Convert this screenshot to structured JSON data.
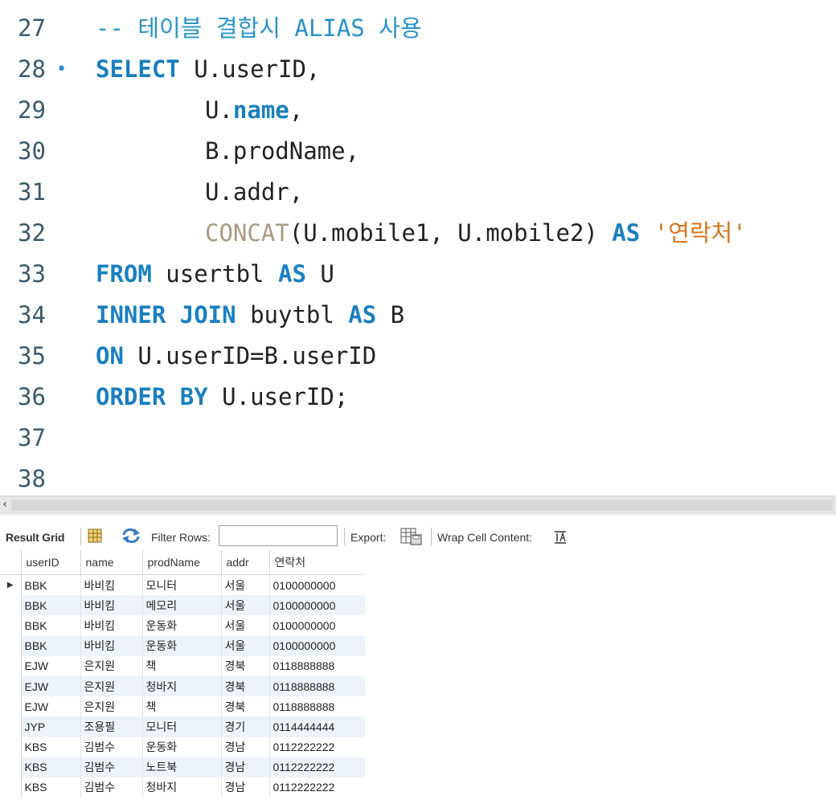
{
  "editor": {
    "lines": [
      {
        "num": "27",
        "comment": "-- 테이블 결합시 ALIAS 사용"
      },
      {
        "num": "28",
        "marker": "•",
        "kw1": "SELECT",
        "rest": " U.userID,"
      },
      {
        "num": "29",
        "pre": "U.",
        "kw1": "name",
        "rest": ","
      },
      {
        "num": "30",
        "text": "B.prodName,"
      },
      {
        "num": "31",
        "text": "U.addr,"
      },
      {
        "num": "32",
        "fn": "CONCAT",
        "mid": "(U.mobile1, U.mobile2) ",
        "kw1": "AS",
        "str": "'연락처'"
      },
      {
        "num": "33",
        "kw1": "FROM",
        "mid": " usertbl ",
        "kw2": "AS",
        "rest": " U"
      },
      {
        "num": "34",
        "kw1": "INNER JOIN",
        "mid": " buytbl ",
        "kw2": "AS",
        "rest": " B"
      },
      {
        "num": "35",
        "kw1": "ON",
        "rest": " U.userID=B.userID"
      },
      {
        "num": "36",
        "kw1": "ORDER BY",
        "rest": " U.userID;"
      },
      {
        "num": "37"
      },
      {
        "num": "38"
      }
    ]
  },
  "splitter": {
    "scroll_left": "‹"
  },
  "toolbar": {
    "result_grid_label": "Result Grid",
    "filter_rows_label": "Filter Rows:",
    "filter_rows_value": "",
    "export_label": "Export:",
    "wrap_cell_label": "Wrap Cell Content:",
    "icons": [
      "grid-icon",
      "refresh-icon",
      "export-icon",
      "wrap-text-icon"
    ]
  },
  "grid": {
    "columns": [
      "userID",
      "name",
      "prodName",
      "addr",
      "연락처"
    ],
    "current_row_marker": "▶",
    "rows": [
      [
        "BBK",
        "바비킴",
        "모니터",
        "서울",
        "0100000000"
      ],
      [
        "BBK",
        "바비킴",
        "메모리",
        "서울",
        "0100000000"
      ],
      [
        "BBK",
        "바비킴",
        "운동화",
        "서울",
        "0100000000"
      ],
      [
        "BBK",
        "바비킴",
        "운동화",
        "서울",
        "0100000000"
      ],
      [
        "EJW",
        "은지원",
        "책",
        "경북",
        "0118888888"
      ],
      [
        "EJW",
        "은지원",
        "청바지",
        "경북",
        "0118888888"
      ],
      [
        "EJW",
        "은지원",
        "책",
        "경북",
        "0118888888"
      ],
      [
        "JYP",
        "조용필",
        "모니터",
        "경기",
        "0114444444"
      ],
      [
        "KBS",
        "김범수",
        "운동화",
        "경남",
        "0112222222"
      ],
      [
        "KBS",
        "김범수",
        "노트북",
        "경남",
        "0112222222"
      ],
      [
        "KBS",
        "김범수",
        "청바지",
        "경남",
        "0112222222"
      ]
    ]
  }
}
